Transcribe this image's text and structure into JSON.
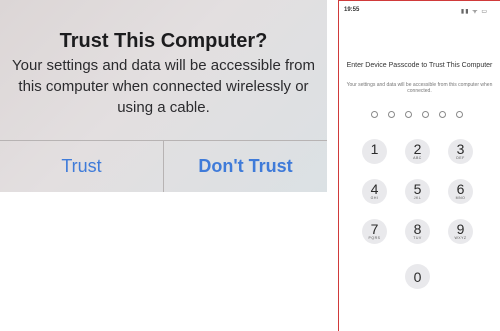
{
  "alert": {
    "title": "Trust This Computer?",
    "message": "Your settings and data will be accessible from this computer when connected wirelessly or using a cable.",
    "trust_label": "Trust",
    "dont_trust_label": "Don't Trust"
  },
  "phone": {
    "status_time": "19:55",
    "status_icons": "▮▮ ᯤ ▭",
    "passcode_title": "Enter Device Passcode to Trust This Computer",
    "passcode_message": "Your settings and data will be accessible from this computer when connected.",
    "keys": [
      {
        "num": "1",
        "letters": ""
      },
      {
        "num": "2",
        "letters": "ABC"
      },
      {
        "num": "3",
        "letters": "DEF"
      },
      {
        "num": "4",
        "letters": "GHI"
      },
      {
        "num": "5",
        "letters": "JKL"
      },
      {
        "num": "6",
        "letters": "MNO"
      },
      {
        "num": "7",
        "letters": "PQRS"
      },
      {
        "num": "8",
        "letters": "TUV"
      },
      {
        "num": "9",
        "letters": "WXYZ"
      },
      {
        "num": "0",
        "letters": ""
      }
    ]
  },
  "colors": {
    "button_blue": "#3f7bd9",
    "divider_red": "#d03a3a",
    "key_background": "#e9e9ec"
  }
}
